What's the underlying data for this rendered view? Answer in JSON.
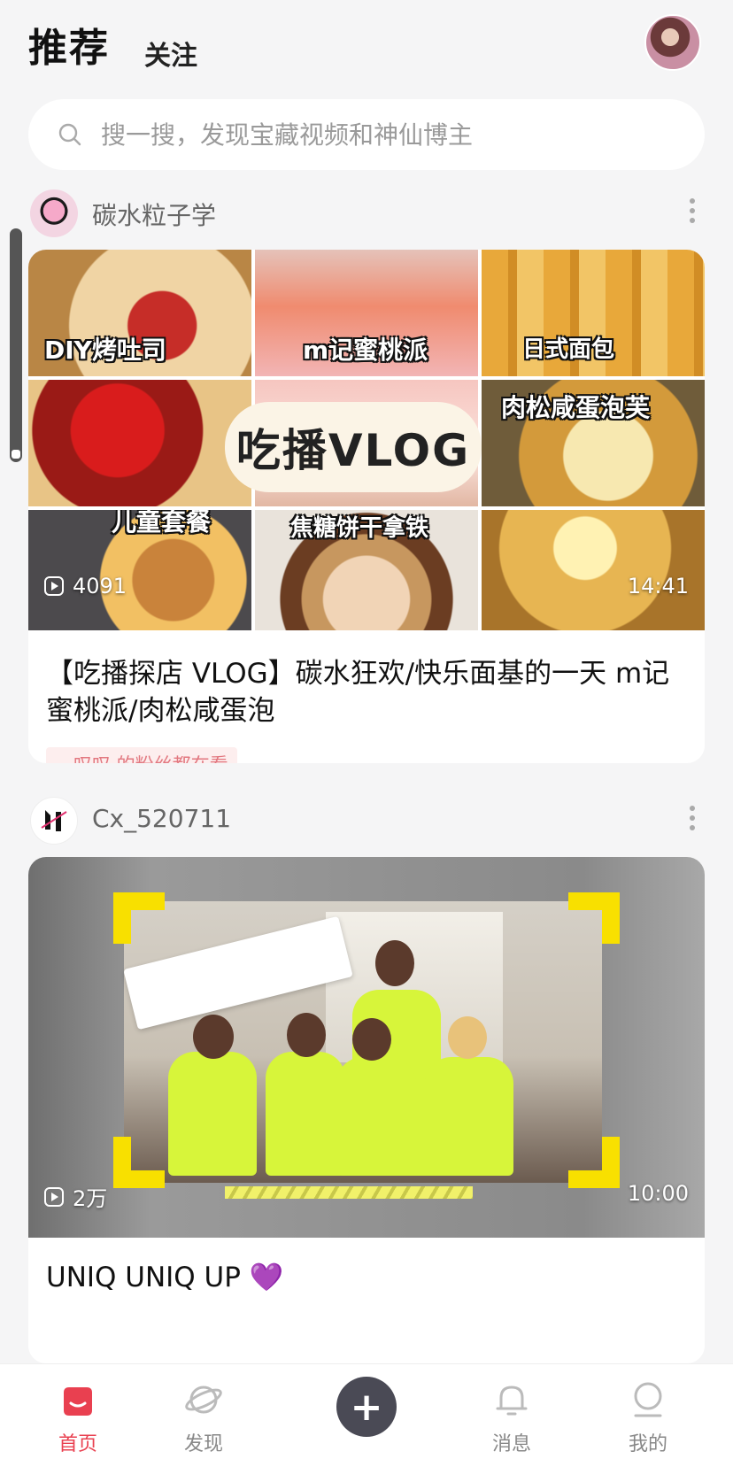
{
  "header": {
    "tab_recommend": "推荐",
    "tab_follow": "关注"
  },
  "search": {
    "placeholder": "搜一搜，发现宝藏视频和神仙博主"
  },
  "feed": [
    {
      "author": "碳水粒子学",
      "cover_labels": [
        "DIY烤吐司",
        "m记蜜桃派",
        "日式面包",
        "肉松咸蛋泡芙",
        "儿童套餐",
        "焦糖饼干拿铁"
      ],
      "cover_badge": "吃播VLOG",
      "play_count": "4091",
      "duration": "14:41",
      "title": "【吃播探店 VLOG】碳水狂欢/快乐面基的一天 m记蜜桃派/肉松咸蛋泡",
      "fan_tag": "__叹叹 的粉丝都在看"
    },
    {
      "author": "Cx_520711",
      "play_count": "2万",
      "duration": "10:00",
      "title": "UNIQ UNIQ UP 💜"
    }
  ],
  "tabbar": {
    "home": "首页",
    "discover": "发现",
    "messages": "消息",
    "mine": "我的",
    "add": "+"
  },
  "colors": {
    "accent": "#e94050",
    "background": "#f5f5f6"
  }
}
